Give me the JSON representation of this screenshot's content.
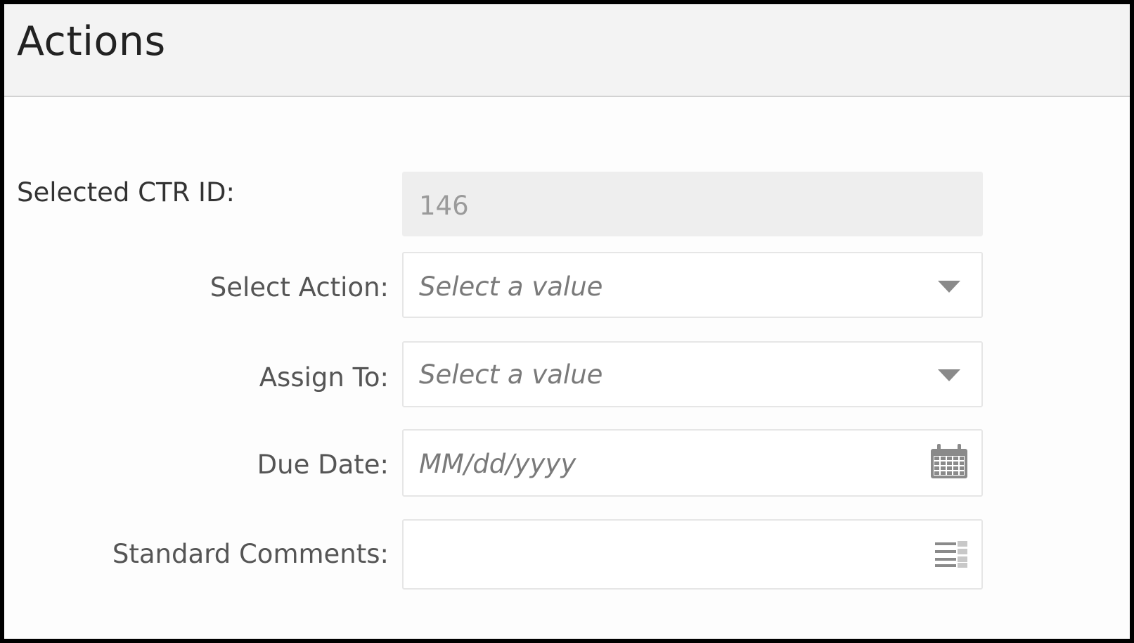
{
  "header": {
    "title": "Actions"
  },
  "form": {
    "selected_ctr_id": {
      "label": "Selected CTR ID:",
      "value": "146"
    },
    "select_action": {
      "label": "Select Action:",
      "placeholder": "Select a value",
      "icon": "dropdown-caret-icon"
    },
    "assign_to": {
      "label": "Assign To:",
      "placeholder": "Select a value",
      "icon": "dropdown-caret-icon"
    },
    "due_date": {
      "label": "Due Date:",
      "placeholder": "MM/dd/yyyy",
      "icon": "calendar-icon"
    },
    "standard_comments": {
      "label": "Standard Comments:",
      "value": "",
      "icon": "list-icon"
    }
  },
  "colors": {
    "header_bg": "#f3f3f3",
    "readonly_bg": "#eeeeee",
    "icon_gray": "#8a8a8a"
  }
}
